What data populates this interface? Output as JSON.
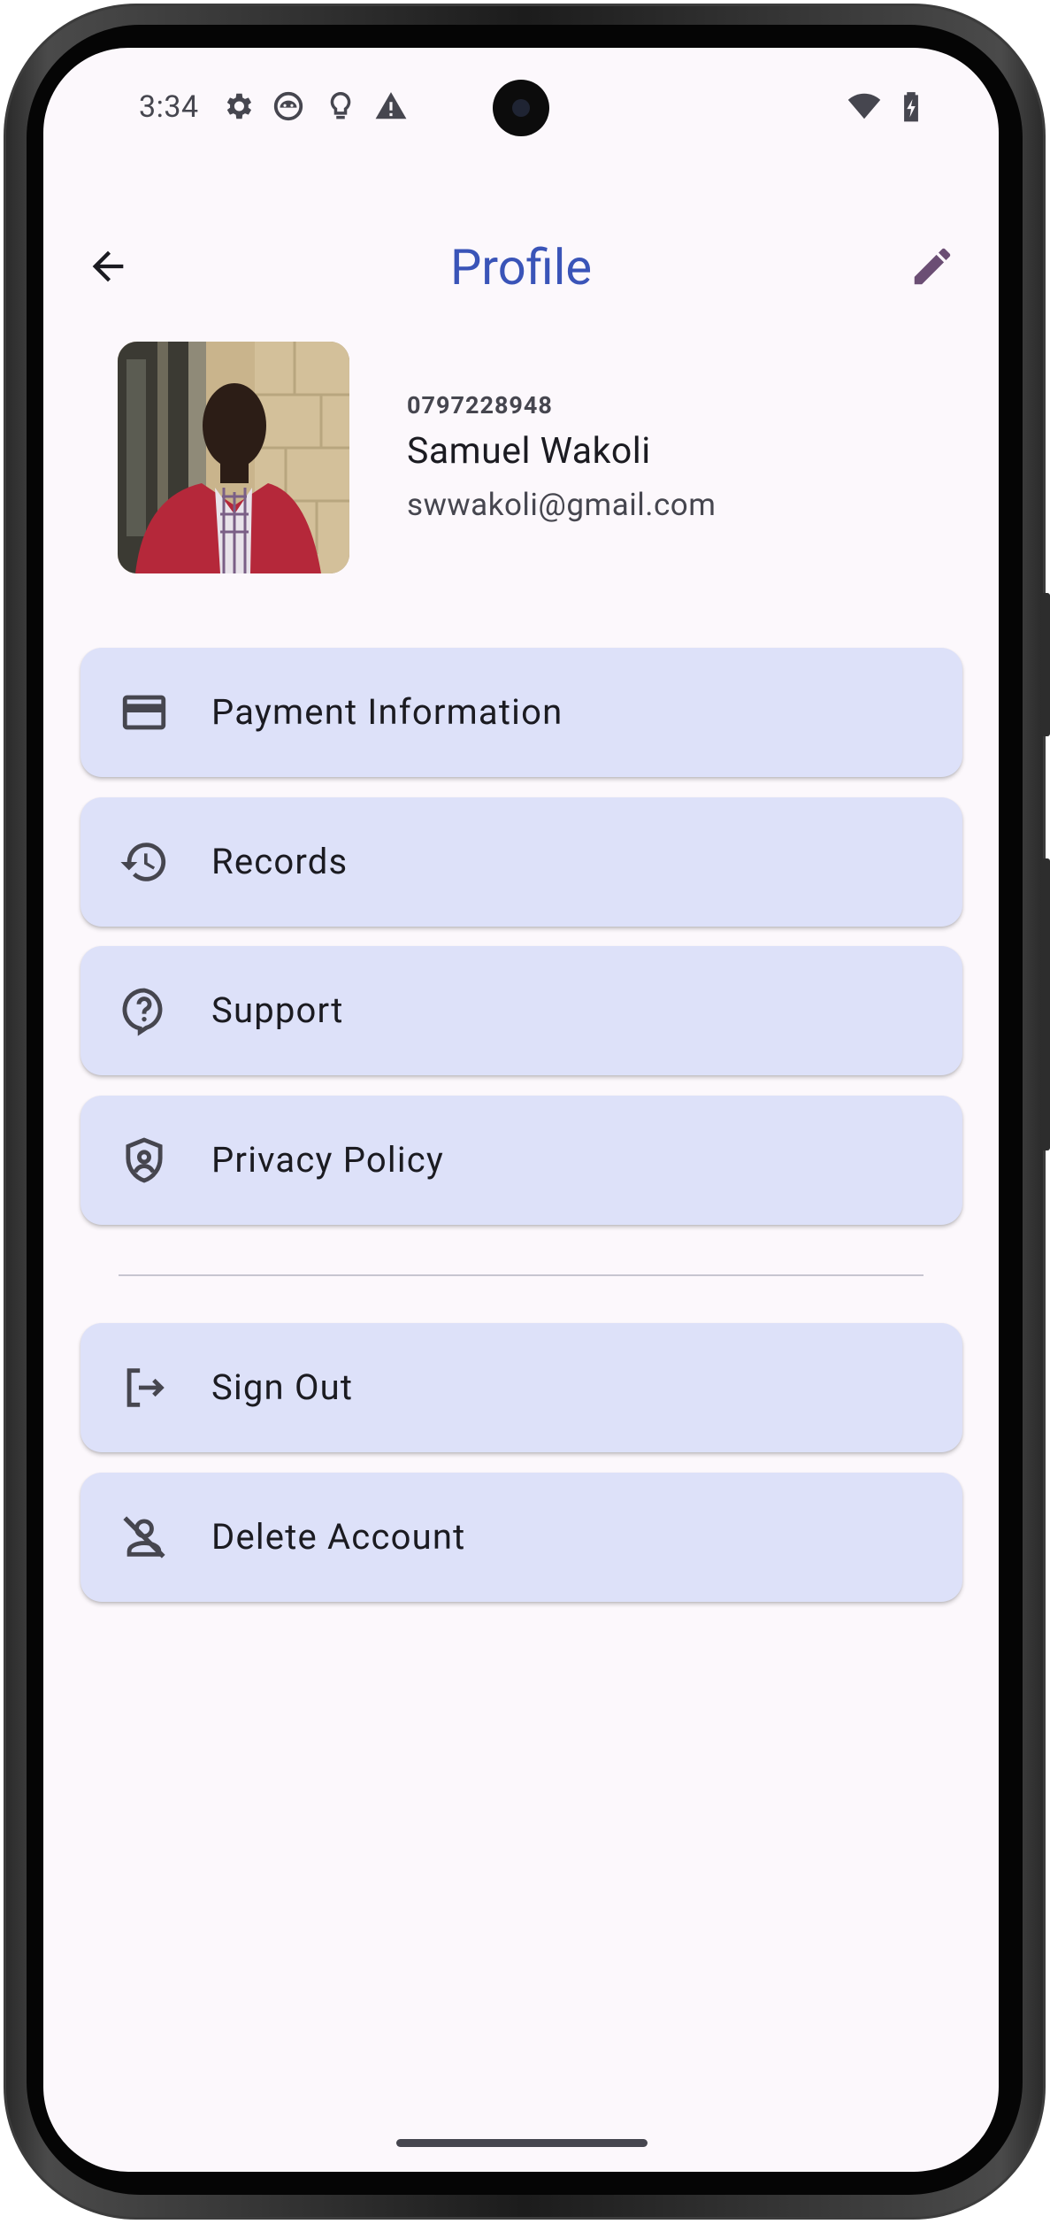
{
  "status_bar": {
    "time": "3:34",
    "icons": [
      "settings-icon",
      "android-head-icon",
      "lightbulb-icon",
      "warning-icon",
      "wifi-icon",
      "battery-charging-icon"
    ]
  },
  "app_bar": {
    "title": "Profile",
    "back_icon": "arrow-back-icon",
    "edit_icon": "pencil-icon",
    "title_color": "#3a54b8",
    "edit_icon_color": "#6b4e74"
  },
  "profile": {
    "phone": "0797228948",
    "name": "Samuel Wakoli",
    "email": "swwakoli@gmail.com"
  },
  "menu": {
    "card_color": "#dde1f9",
    "primary_items": [
      {
        "label": "Payment Information",
        "icon": "credit-card-icon"
      },
      {
        "label": "Records",
        "icon": "history-icon"
      },
      {
        "label": "Support",
        "icon": "help-bubble-icon"
      },
      {
        "label": "Privacy Policy",
        "icon": "shield-icon"
      }
    ],
    "account_items": [
      {
        "label": "Sign Out",
        "icon": "logout-icon"
      },
      {
        "label": "Delete Account",
        "icon": "person-off-icon"
      }
    ]
  }
}
